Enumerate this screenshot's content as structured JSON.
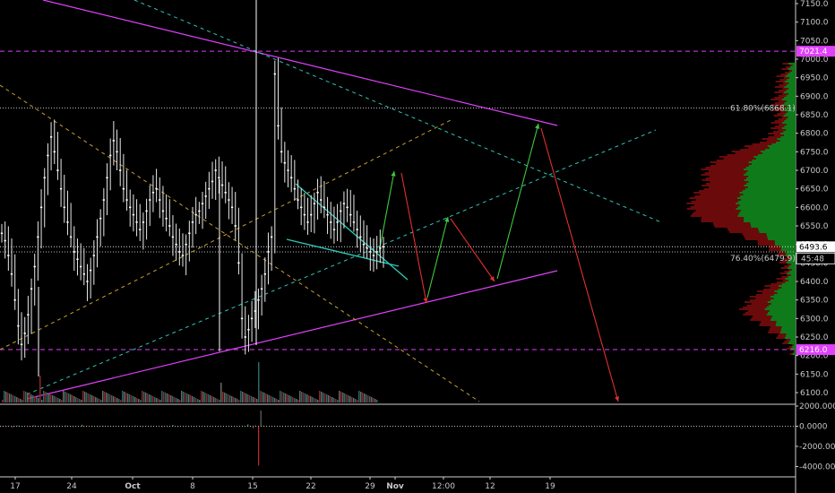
{
  "chart_data": {
    "type": "candlestick",
    "price_axis": {
      "ticks": [
        "7150.0",
        "7100.0",
        "7050.0",
        "7000.0",
        "6950.0",
        "6900.0",
        "6850.0",
        "6800.0",
        "6750.0",
        "6700.0",
        "6650.0",
        "6600.0",
        "6550.0",
        "6500.0",
        "6450.0",
        "6400.0",
        "6350.0",
        "6300.0",
        "6250.0",
        "6200.0",
        "6150.0",
        "6100.0"
      ],
      "range": [
        6085,
        7160
      ]
    },
    "time_axis": {
      "ticks": [
        "17",
        "24",
        "Oct",
        "8",
        "15",
        "22",
        "29",
        "Nov",
        "12:00",
        "12",
        "19"
      ]
    },
    "indicator_axis": {
      "ticks": [
        "2000.0000",
        "0.0000",
        "-2000.0000",
        "-4000.0000"
      ]
    },
    "price_labels": {
      "top_level": {
        "value": 7021.4,
        "text": "7021.4",
        "color": "#e040fb"
      },
      "bottom_level": {
        "value": 6216.0,
        "text": "6216.0",
        "color": "#e040fb"
      },
      "last_price": {
        "value": 6493.6,
        "text": "6493.6",
        "countdown": "45:48"
      },
      "fib_618": {
        "value": 6868.1,
        "text": "61.80%(6868.1)"
      },
      "fib_764": {
        "value": 6479.9,
        "text": "76.40%(6479.9)"
      }
    },
    "price_series": [
      6530,
      6510,
      6470,
      6420,
      6350,
      6280,
      6230,
      6260,
      6310,
      6380,
      6440,
      6520,
      6600,
      6680,
      6740,
      6790,
      6750,
      6700,
      6650,
      6600,
      6560,
      6520,
      6480,
      6460,
      6440,
      6420,
      6400,
      6430,
      6470,
      6520,
      6570,
      6620,
      6680,
      6740,
      6780,
      6750,
      6700,
      6650,
      6620,
      6600,
      6580,
      6560,
      6540,
      6560,
      6590,
      6620,
      6640,
      6650,
      6620,
      6590,
      6570,
      6550,
      6520,
      6500,
      6480,
      6470,
      6500,
      6530,
      6560,
      6580,
      6590,
      6610,
      6630,
      6650,
      6670,
      6700,
      6680,
      6660,
      6640,
      6620,
      6600,
      6550,
      6450,
      6300,
      6250,
      6270,
      6300,
      6320,
      6350,
      6380,
      6420,
      6480,
      6520,
      6960,
      6820,
      6750,
      6720,
      6700,
      6680,
      6650,
      6620,
      6600,
      6580,
      6560,
      6580,
      6610,
      6640,
      6620,
      6600,
      6580,
      6560,
      6540,
      6560,
      6590,
      6610,
      6600,
      6580,
      6560,
      6540,
      6520,
      6500,
      6490,
      6480,
      6470,
      6480,
      6490,
      6493.6
    ],
    "indicator_series": [
      -60,
      40,
      -120,
      80,
      30,
      -50,
      90,
      -30,
      60,
      -80,
      40,
      -20,
      70,
      -60,
      20,
      150,
      -40,
      30,
      -70,
      50,
      -30,
      20,
      -10,
      40,
      -20,
      60,
      -50,
      30,
      -40,
      20,
      -90,
      40,
      120,
      -60,
      30,
      -20,
      10,
      -30,
      20,
      -10,
      30,
      -20,
      10,
      -30,
      20,
      -10,
      180,
      -200,
      -3900,
      60,
      -40,
      30,
      -20,
      20,
      -30,
      40,
      -10,
      20,
      -20,
      10,
      -30,
      20,
      -40,
      30,
      -20,
      10,
      -10,
      20,
      -30,
      10,
      -20,
      30
    ],
    "grid": false,
    "legend": "none"
  }
}
